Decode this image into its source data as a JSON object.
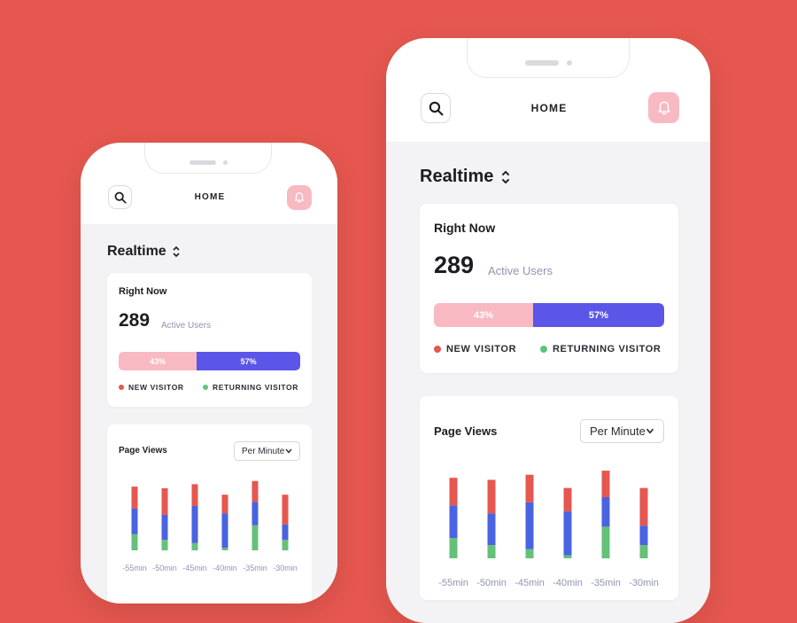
{
  "header": {
    "title": "HOME"
  },
  "icons": {
    "search": "search-icon",
    "notifications": "bell-icon",
    "sort": "sort-arrows-icon",
    "dropdown": "chevron-down-icon"
  },
  "section": {
    "title": "Realtime"
  },
  "right_now": {
    "title": "Right Now",
    "active_users": "289",
    "active_users_label": "Active Users",
    "new_visitor_pct_label": "43%",
    "returning_visitor_pct_label": "57%",
    "new_visitor_fraction": 0.43,
    "returning_visitor_fraction": 0.57,
    "legend_new": "NEW VISITOR",
    "legend_returning": "RETURNING VISITOR"
  },
  "page_views": {
    "title": "Page Views",
    "range_selected": "Per Minute"
  },
  "colors": {
    "background": "#E5574F",
    "new_visitor": "#F8B9C3",
    "returning_visitor": "#5B55E8",
    "new_dot": "#E5574F",
    "returning_dot": "#5CC47A",
    "bar_red": "#E5574F",
    "bar_blue": "#4A63E0",
    "bar_green": "#65C07A"
  },
  "chart_data": {
    "type": "bar",
    "stacked": true,
    "categories": [
      "-55min",
      "-50min",
      "-45min",
      "-40min",
      "-35min",
      "-30min"
    ],
    "series": [
      {
        "values": [
          27,
          33,
          27,
          23,
          26,
          37
        ]
      },
      {
        "values": [
          32,
          31,
          46,
          43,
          29,
          19
        ]
      },
      {
        "values": [
          20,
          13,
          9,
          3,
          31,
          13
        ]
      }
    ]
  }
}
